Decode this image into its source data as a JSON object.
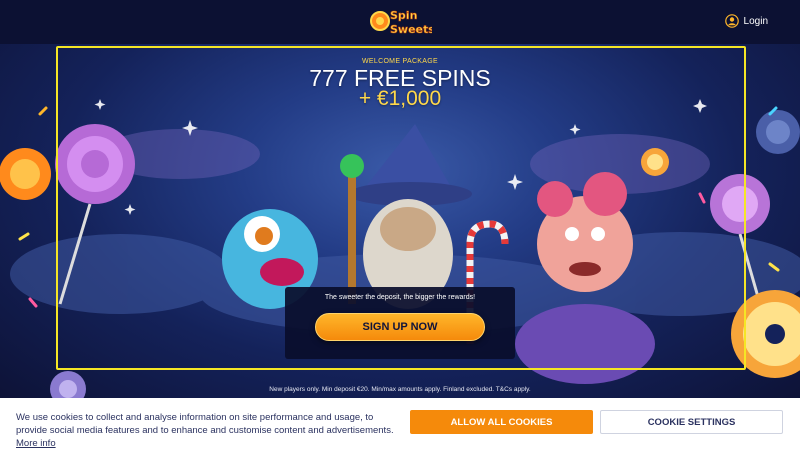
{
  "header": {
    "logo_text_line1": "Spin",
    "logo_text_line2": "Sweets",
    "login_label": "Login",
    "logo_icon": "spin-sweets-logo",
    "login_icon": "user-circle-icon"
  },
  "promo": {
    "welcome_label": "WELCOME PACKAGE",
    "title": "777 FREE SPINS",
    "amount": "+ €1,000",
    "tagline": "The sweeter the deposit, the bigger the rewards!",
    "signup_label": "SIGN UP NOW",
    "terms": "New players only. Min deposit €20. Min/max amounts apply. Finland excluded. T&Cs apply."
  },
  "cookie": {
    "text": "We use cookies to collect and analyse information on site performance and usage, to provide social media features and to enhance and customise content and advertisements.",
    "more_info": "More info",
    "allow_label": "ALLOW ALL COOKIES",
    "settings_label": "COOKIE SETTINGS"
  },
  "colors": {
    "accent_orange": "#f58a0b",
    "frame_yellow": "#f5e625",
    "navy": "#0d1236",
    "gold_text": "#ffd84a"
  }
}
